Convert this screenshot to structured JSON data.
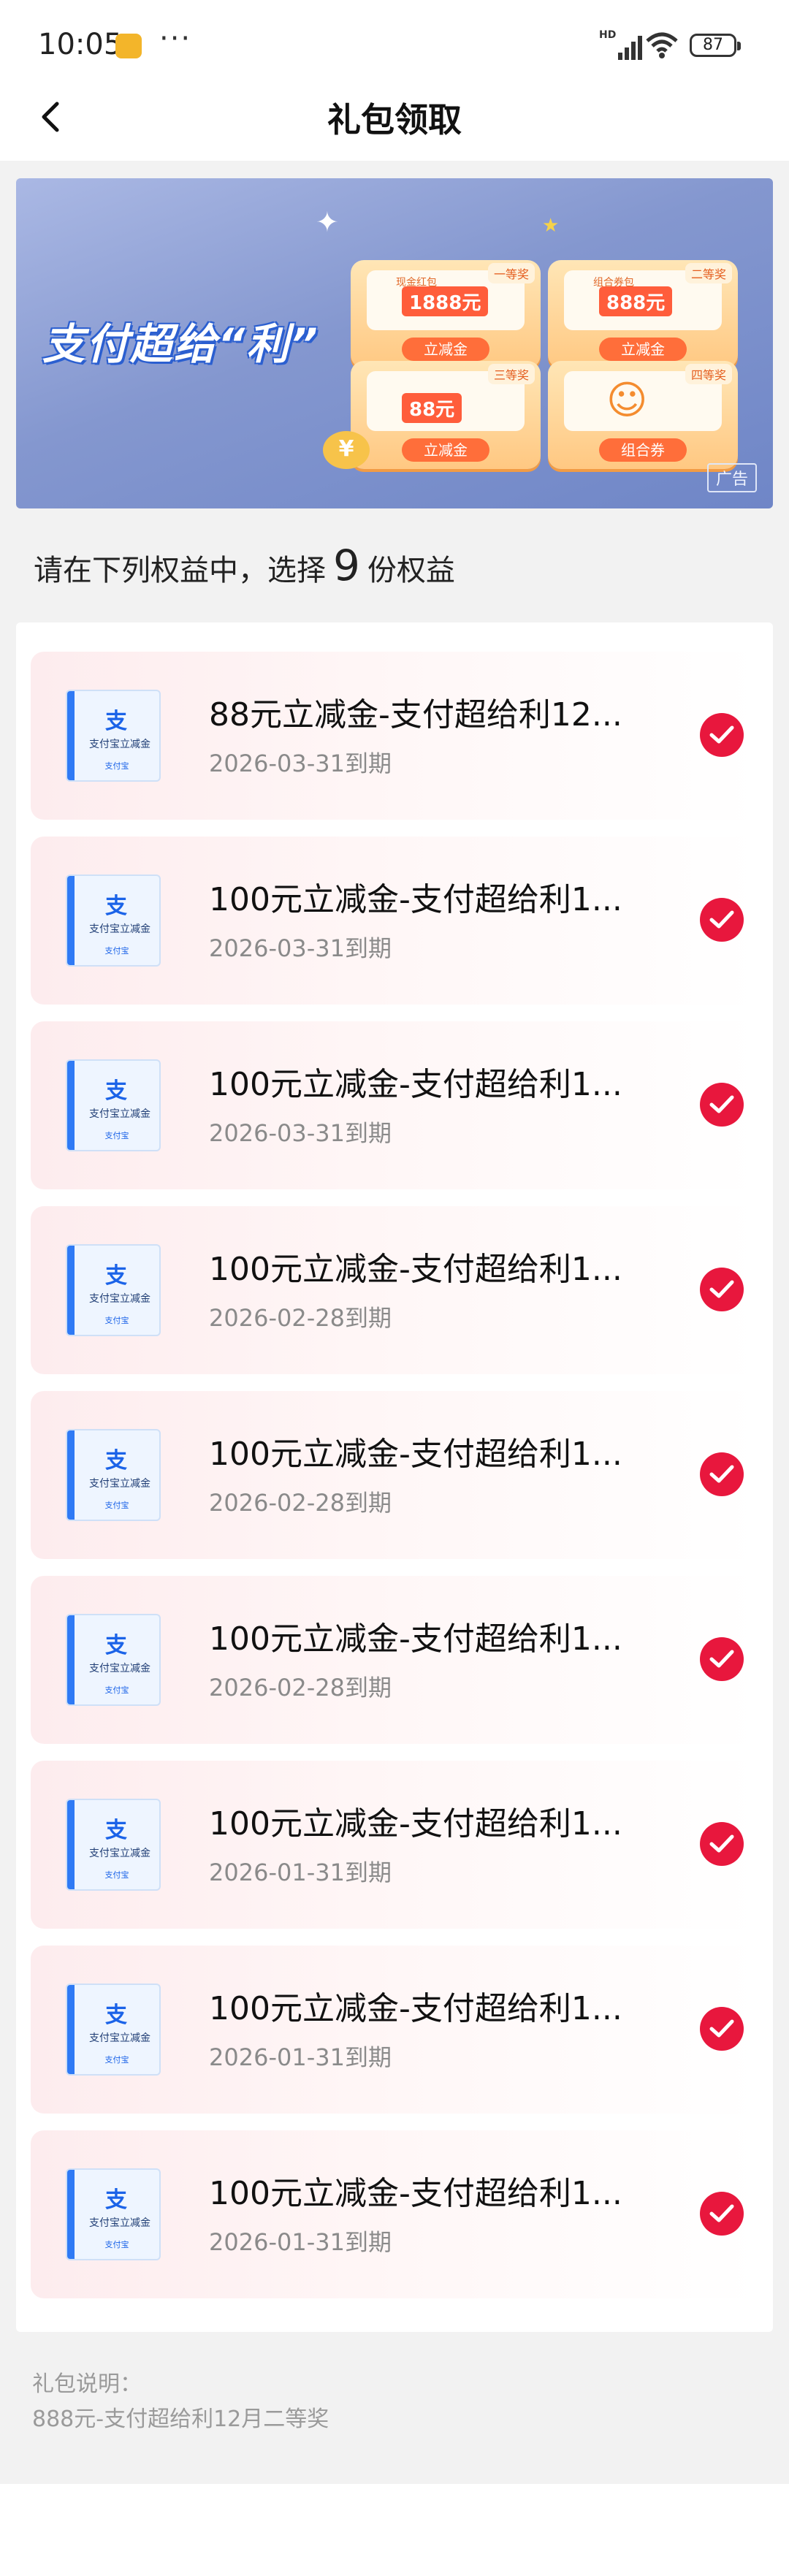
{
  "status_bar": {
    "time": "10:05",
    "more": "···",
    "network_label": "HD",
    "battery": "87"
  },
  "nav": {
    "title": "礼包领取"
  },
  "banner": {
    "brand": "支付超给“利”",
    "cards": [
      {
        "tag": "一等奖",
        "sub": "现金红包",
        "amount": "1888元",
        "button": "立减金"
      },
      {
        "tag": "二等奖",
        "sub": "组合券包",
        "amount": "888元",
        "button": "立减金"
      },
      {
        "tag": "三等奖",
        "sub": "",
        "amount": "88元",
        "button": "立减金"
      },
      {
        "tag": "四等奖",
        "sub": "",
        "amount": "",
        "button": "组合券"
      }
    ],
    "coin": "¥",
    "ad_label": "广告"
  },
  "instruction": {
    "prefix": "请在下列权益中，选择",
    "count": "9",
    "suffix": "份权益"
  },
  "items": [
    {
      "name": "88元立减金-支付超给利12...",
      "expiry": "2026-03-31到期",
      "thumb_brand": "支",
      "thumb_label": "支付宝立减金",
      "thumb_mini": "支付宝",
      "selected": true
    },
    {
      "name": "100元立减金-支付超给利1...",
      "expiry": "2026-03-31到期",
      "thumb_brand": "支",
      "thumb_label": "支付宝立减金",
      "thumb_mini": "支付宝",
      "selected": true
    },
    {
      "name": "100元立减金-支付超给利1...",
      "expiry": "2026-03-31到期",
      "thumb_brand": "支",
      "thumb_label": "支付宝立减金",
      "thumb_mini": "支付宝",
      "selected": true
    },
    {
      "name": "100元立减金-支付超给利1...",
      "expiry": "2026-02-28到期",
      "thumb_brand": "支",
      "thumb_label": "支付宝立减金",
      "thumb_mini": "支付宝",
      "selected": true
    },
    {
      "name": "100元立减金-支付超给利1...",
      "expiry": "2026-02-28到期",
      "thumb_brand": "支",
      "thumb_label": "支付宝立减金",
      "thumb_mini": "支付宝",
      "selected": true
    },
    {
      "name": "100元立减金-支付超给利1...",
      "expiry": "2026-02-28到期",
      "thumb_brand": "支",
      "thumb_label": "支付宝立减金",
      "thumb_mini": "支付宝",
      "selected": true
    },
    {
      "name": "100元立减金-支付超给利1...",
      "expiry": "2026-01-31到期",
      "thumb_brand": "支",
      "thumb_label": "支付宝立减金",
      "thumb_mini": "支付宝",
      "selected": true
    },
    {
      "name": "100元立减金-支付超给利1...",
      "expiry": "2026-01-31到期",
      "thumb_brand": "支",
      "thumb_label": "支付宝立减金",
      "thumb_mini": "支付宝",
      "selected": true
    },
    {
      "name": "100元立减金-支付超给利1...",
      "expiry": "2026-01-31到期",
      "thumb_brand": "支",
      "thumb_label": "支付宝立减金",
      "thumb_mini": "支付宝",
      "selected": true
    }
  ],
  "description": {
    "label": "礼包说明：",
    "text": "888元-支付超给利12月二等奖"
  },
  "colors": {
    "accent": "#e8173d",
    "banner": "#8497cf",
    "page_bg": "#f2f2f2"
  }
}
